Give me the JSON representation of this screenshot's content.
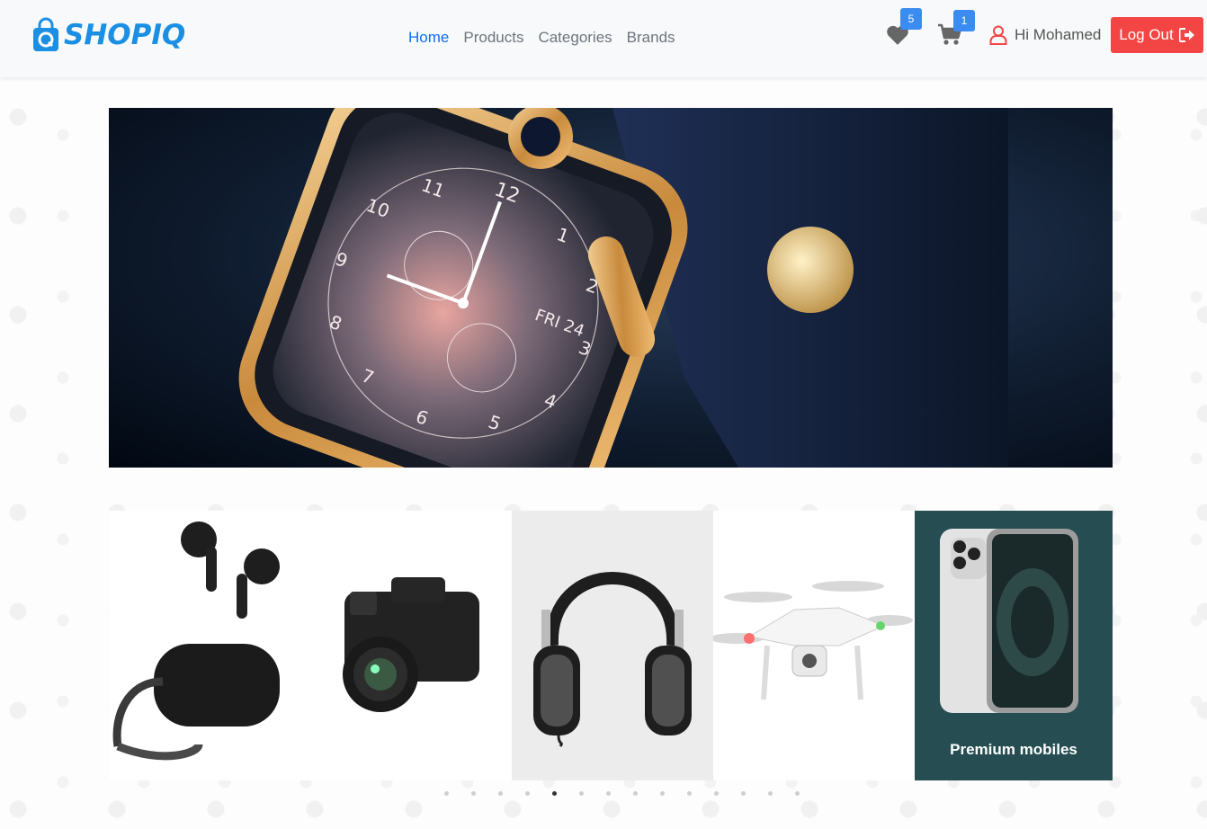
{
  "brand": {
    "name": "SHOPIQ",
    "color": "#1a8fe3"
  },
  "nav": {
    "links": [
      {
        "label": "Home",
        "active": true
      },
      {
        "label": "Products",
        "active": false
      },
      {
        "label": "Categories",
        "active": false
      },
      {
        "label": "Brands",
        "active": false
      }
    ]
  },
  "header": {
    "wishlist_count": "5",
    "cart_count": "1",
    "greeting": "Hi Mohamed",
    "logout_label": "Log Out",
    "logout_color": "#f44545",
    "badge_color": "#3b8cf0"
  },
  "hero": {
    "image": "smartwatch-banner",
    "watch_date": "FRI 24",
    "dial_numbers": [
      "12",
      "1",
      "2",
      "3",
      "4",
      "5",
      "6",
      "7",
      "8",
      "9",
      "10",
      "11"
    ]
  },
  "carousel": {
    "slides": [
      {
        "image": "wireless-earbuds",
        "caption": ""
      },
      {
        "image": "dslr-camera",
        "caption": ""
      },
      {
        "image": "headphones",
        "caption": ""
      },
      {
        "image": "drone",
        "caption": ""
      },
      {
        "image": "smartphone",
        "caption": "Premium mobiles"
      }
    ],
    "dot_count": 14,
    "active_dot_index": 4
  }
}
